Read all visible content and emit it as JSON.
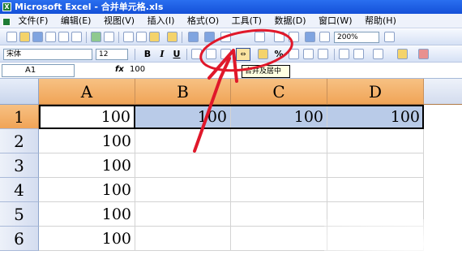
{
  "window": {
    "title": "Microsoft Excel - 合并单元格.xls"
  },
  "menu": [
    "文件(F)",
    "编辑(E)",
    "视图(V)",
    "插入(I)",
    "格式(O)",
    "工具(T)",
    "数据(D)",
    "窗口(W)",
    "帮助(H)"
  ],
  "toolbar": {
    "zoom": "200%"
  },
  "format_toolbar": {
    "font": "宋体",
    "size": "12",
    "bold": "B",
    "italic": "I",
    "underline": "U",
    "percent": "%",
    "merge_tooltip": "合并及居中"
  },
  "formula_bar": {
    "cell_ref": "A1",
    "fx": "fx",
    "value": "100"
  },
  "sheet": {
    "columns": [
      "A",
      "B",
      "C",
      "D"
    ],
    "rows": [
      "1",
      "2",
      "3",
      "4",
      "5",
      "6"
    ],
    "row1": [
      "100",
      "100",
      "100",
      "100"
    ],
    "colA": [
      "100",
      "100",
      "100",
      "100",
      "100"
    ]
  },
  "colors": {
    "annotation": "#e0182a",
    "column_header": "#f0a457",
    "selection": "#b9cbe8"
  },
  "icons": [
    "excel-icon",
    "new-icon",
    "open-icon",
    "save-icon",
    "print-icon",
    "cut-icon",
    "copy-icon",
    "paste-icon",
    "undo-icon",
    "sort-icon",
    "merge-center-icon",
    "fill-color-icon",
    "font-color-icon"
  ]
}
